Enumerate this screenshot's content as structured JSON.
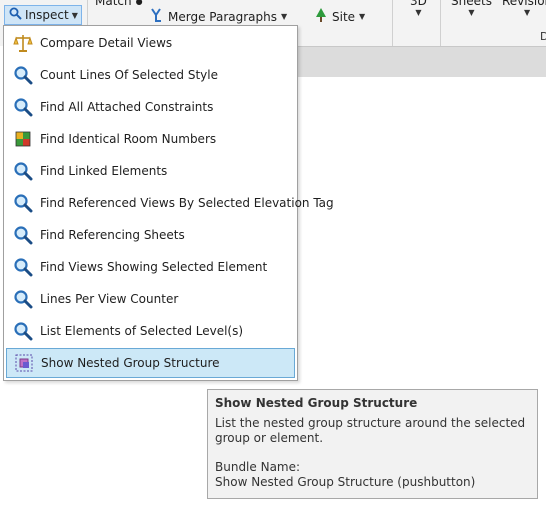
{
  "ribbon": {
    "inspect_label": "Inspect",
    "match_label": "Match",
    "merge_label": "Merge Paragraphs",
    "site_label": "Site",
    "view3d_label": "3D",
    "sheets_label": "Sheets",
    "revisions_label": "Revision",
    "panel_label_d": "D"
  },
  "menu": {
    "items": [
      {
        "label": "Compare Detail Views",
        "icon": "scales-icon"
      },
      {
        "label": "Count Lines Of Selected Style",
        "icon": "magnifier-icon"
      },
      {
        "label": "Find All Attached Constraints",
        "icon": "magnifier-icon"
      },
      {
        "label": "Find Identical Room Numbers",
        "icon": "room-cube-icon"
      },
      {
        "label": "Find Linked Elements",
        "icon": "magnifier-icon"
      },
      {
        "label": "Find Referenced Views By Selected Elevation Tag",
        "icon": "magnifier-icon"
      },
      {
        "label": "Find Referencing Sheets",
        "icon": "magnifier-icon"
      },
      {
        "label": "Find Views Showing Selected Element",
        "icon": "magnifier-icon"
      },
      {
        "label": "Lines Per View Counter",
        "icon": "magnifier-icon"
      },
      {
        "label": "List Elements of Selected Level(s)",
        "icon": "magnifier-icon"
      },
      {
        "label": "Show Nested Group Structure",
        "icon": "nested-group-icon"
      }
    ]
  },
  "tooltip": {
    "title": "Show Nested Group Structure",
    "description": "List the nested group structure around the selected group or element.",
    "bundle_label": "Bundle Name:",
    "bundle_value": "Show Nested Group Structure (pushbutton)"
  }
}
